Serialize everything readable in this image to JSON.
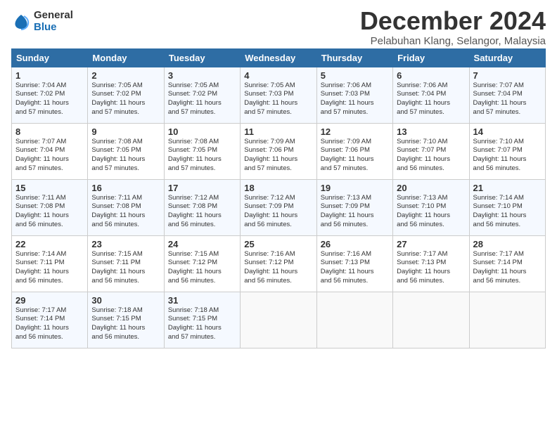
{
  "logo": {
    "general": "General",
    "blue": "Blue"
  },
  "title": "December 2024",
  "location": "Pelabuhan Klang, Selangor, Malaysia",
  "days_header": [
    "Sunday",
    "Monday",
    "Tuesday",
    "Wednesday",
    "Thursday",
    "Friday",
    "Saturday"
  ],
  "weeks": [
    [
      {
        "day": "1",
        "text": "Sunrise: 7:04 AM\nSunset: 7:02 PM\nDaylight: 11 hours\nand 57 minutes."
      },
      {
        "day": "2",
        "text": "Sunrise: 7:05 AM\nSunset: 7:02 PM\nDaylight: 11 hours\nand 57 minutes."
      },
      {
        "day": "3",
        "text": "Sunrise: 7:05 AM\nSunset: 7:02 PM\nDaylight: 11 hours\nand 57 minutes."
      },
      {
        "day": "4",
        "text": "Sunrise: 7:05 AM\nSunset: 7:03 PM\nDaylight: 11 hours\nand 57 minutes."
      },
      {
        "day": "5",
        "text": "Sunrise: 7:06 AM\nSunset: 7:03 PM\nDaylight: 11 hours\nand 57 minutes."
      },
      {
        "day": "6",
        "text": "Sunrise: 7:06 AM\nSunset: 7:04 PM\nDaylight: 11 hours\nand 57 minutes."
      },
      {
        "day": "7",
        "text": "Sunrise: 7:07 AM\nSunset: 7:04 PM\nDaylight: 11 hours\nand 57 minutes."
      }
    ],
    [
      {
        "day": "8",
        "text": "Sunrise: 7:07 AM\nSunset: 7:04 PM\nDaylight: 11 hours\nand 57 minutes."
      },
      {
        "day": "9",
        "text": "Sunrise: 7:08 AM\nSunset: 7:05 PM\nDaylight: 11 hours\nand 57 minutes."
      },
      {
        "day": "10",
        "text": "Sunrise: 7:08 AM\nSunset: 7:05 PM\nDaylight: 11 hours\nand 57 minutes."
      },
      {
        "day": "11",
        "text": "Sunrise: 7:09 AM\nSunset: 7:06 PM\nDaylight: 11 hours\nand 57 minutes."
      },
      {
        "day": "12",
        "text": "Sunrise: 7:09 AM\nSunset: 7:06 PM\nDaylight: 11 hours\nand 57 minutes."
      },
      {
        "day": "13",
        "text": "Sunrise: 7:10 AM\nSunset: 7:07 PM\nDaylight: 11 hours\nand 56 minutes."
      },
      {
        "day": "14",
        "text": "Sunrise: 7:10 AM\nSunset: 7:07 PM\nDaylight: 11 hours\nand 56 minutes."
      }
    ],
    [
      {
        "day": "15",
        "text": "Sunrise: 7:11 AM\nSunset: 7:08 PM\nDaylight: 11 hours\nand 56 minutes."
      },
      {
        "day": "16",
        "text": "Sunrise: 7:11 AM\nSunset: 7:08 PM\nDaylight: 11 hours\nand 56 minutes."
      },
      {
        "day": "17",
        "text": "Sunrise: 7:12 AM\nSunset: 7:08 PM\nDaylight: 11 hours\nand 56 minutes."
      },
      {
        "day": "18",
        "text": "Sunrise: 7:12 AM\nSunset: 7:09 PM\nDaylight: 11 hours\nand 56 minutes."
      },
      {
        "day": "19",
        "text": "Sunrise: 7:13 AM\nSunset: 7:09 PM\nDaylight: 11 hours\nand 56 minutes."
      },
      {
        "day": "20",
        "text": "Sunrise: 7:13 AM\nSunset: 7:10 PM\nDaylight: 11 hours\nand 56 minutes."
      },
      {
        "day": "21",
        "text": "Sunrise: 7:14 AM\nSunset: 7:10 PM\nDaylight: 11 hours\nand 56 minutes."
      }
    ],
    [
      {
        "day": "22",
        "text": "Sunrise: 7:14 AM\nSunset: 7:11 PM\nDaylight: 11 hours\nand 56 minutes."
      },
      {
        "day": "23",
        "text": "Sunrise: 7:15 AM\nSunset: 7:11 PM\nDaylight: 11 hours\nand 56 minutes."
      },
      {
        "day": "24",
        "text": "Sunrise: 7:15 AM\nSunset: 7:12 PM\nDaylight: 11 hours\nand 56 minutes."
      },
      {
        "day": "25",
        "text": "Sunrise: 7:16 AM\nSunset: 7:12 PM\nDaylight: 11 hours\nand 56 minutes."
      },
      {
        "day": "26",
        "text": "Sunrise: 7:16 AM\nSunset: 7:13 PM\nDaylight: 11 hours\nand 56 minutes."
      },
      {
        "day": "27",
        "text": "Sunrise: 7:17 AM\nSunset: 7:13 PM\nDaylight: 11 hours\nand 56 minutes."
      },
      {
        "day": "28",
        "text": "Sunrise: 7:17 AM\nSunset: 7:14 PM\nDaylight: 11 hours\nand 56 minutes."
      }
    ],
    [
      {
        "day": "29",
        "text": "Sunrise: 7:17 AM\nSunset: 7:14 PM\nDaylight: 11 hours\nand 56 minutes."
      },
      {
        "day": "30",
        "text": "Sunrise: 7:18 AM\nSunset: 7:15 PM\nDaylight: 11 hours\nand 56 minutes."
      },
      {
        "day": "31",
        "text": "Sunrise: 7:18 AM\nSunset: 7:15 PM\nDaylight: 11 hours\nand 57 minutes."
      },
      {
        "day": "",
        "text": ""
      },
      {
        "day": "",
        "text": ""
      },
      {
        "day": "",
        "text": ""
      },
      {
        "day": "",
        "text": ""
      }
    ]
  ]
}
